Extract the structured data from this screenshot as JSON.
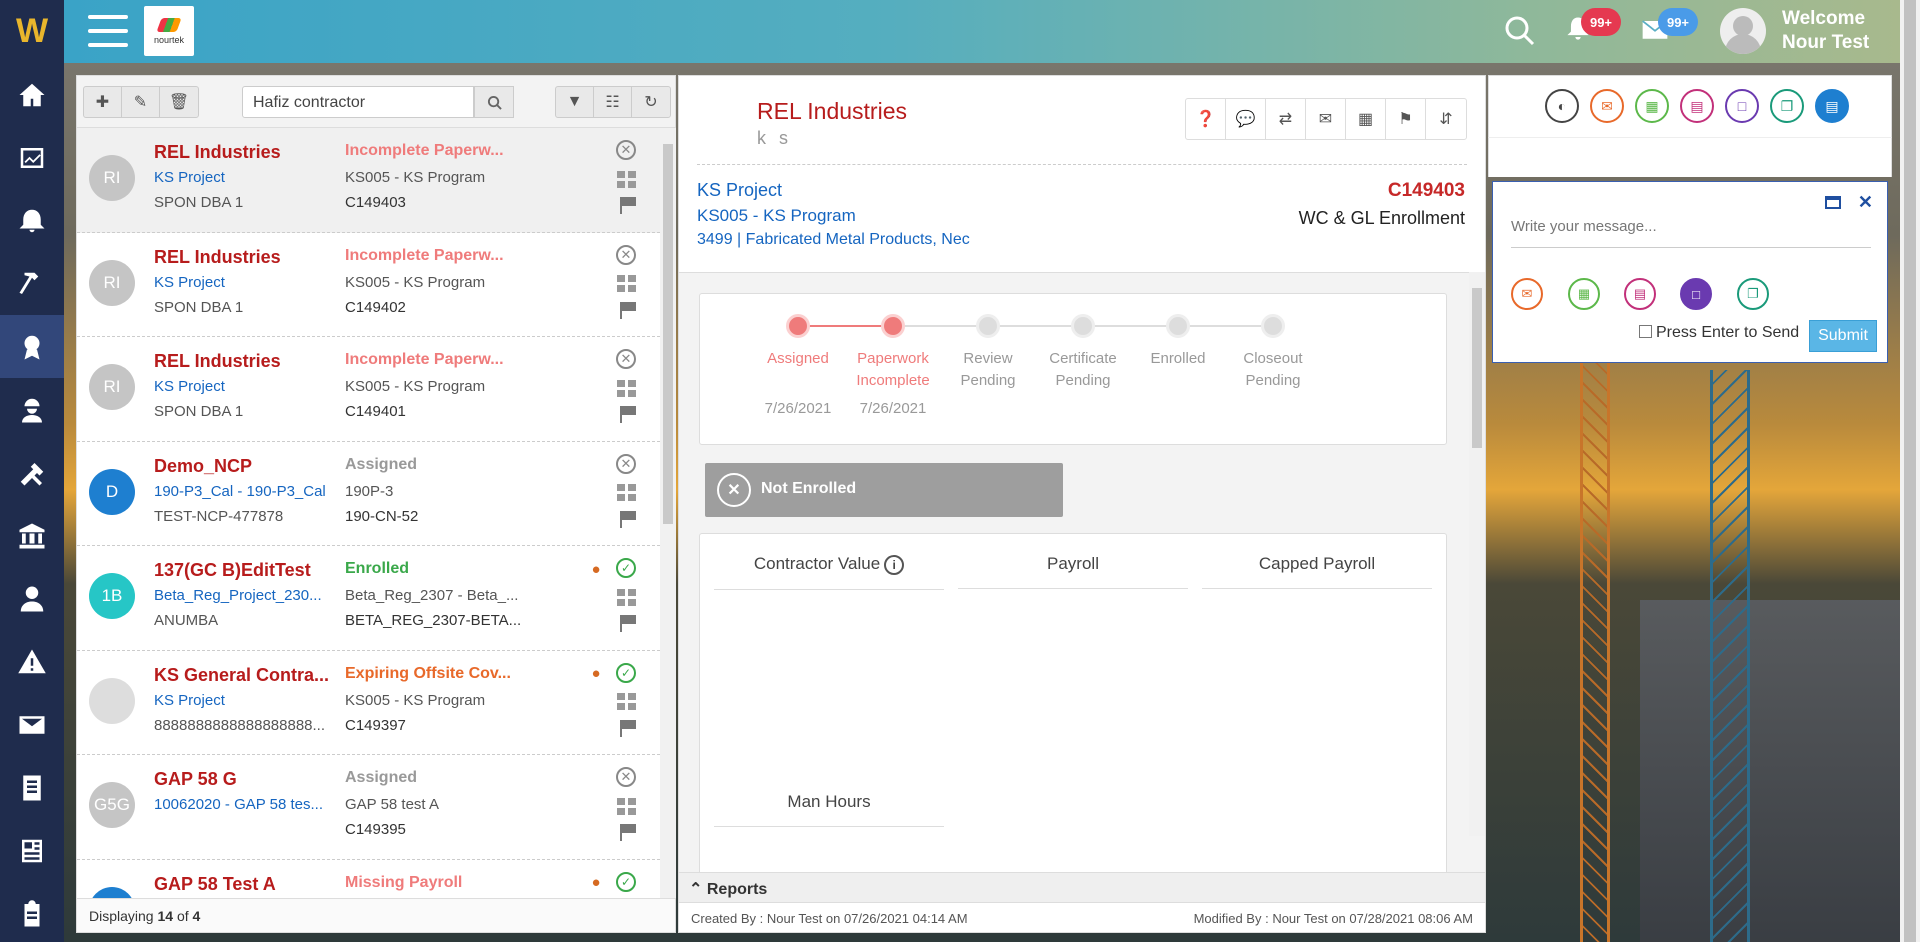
{
  "colors": {
    "brand_red": "#b71c1c",
    "link_blue": "#1565c0",
    "sidebar_bg": "#1f2c4d",
    "accent_green": "#3aa84a",
    "step_done": "#ef7b7b"
  },
  "header": {
    "brand_text": "nourtek",
    "notifications_badge": "99+",
    "mail_badge": "99+",
    "welcome_line1": "Welcome",
    "welcome_line2": "Nour Test"
  },
  "sidebar": {
    "logo": "W",
    "items": [
      {
        "icon": "home-icon"
      },
      {
        "icon": "chart-icon"
      },
      {
        "icon": "bell-icon"
      },
      {
        "icon": "hammer-icon"
      },
      {
        "icon": "award-icon",
        "active": true
      },
      {
        "icon": "worker-icon"
      },
      {
        "icon": "tools-icon"
      },
      {
        "icon": "bank-icon"
      },
      {
        "icon": "agent-icon"
      },
      {
        "icon": "warning-icon"
      },
      {
        "icon": "mail-icon"
      },
      {
        "icon": "document-icon"
      },
      {
        "icon": "newspaper-icon"
      },
      {
        "icon": "clipboard-icon"
      }
    ]
  },
  "list_panel": {
    "search_value": "Hafiz contractor",
    "footer_prefix": "Displaying",
    "footer_count": "14",
    "footer_of": "of",
    "footer_total": "4",
    "rows": [
      {
        "initials": "RI",
        "avatar_color": "#c5c5c5",
        "name": "REL Industries",
        "project": "KS Project",
        "dba": "SPON DBA 1",
        "status": "Incomplete Paperw...",
        "status_color": "#ef7b7b",
        "program": "KS005 - KS Program",
        "contract": "C149403",
        "state": "x",
        "selected": true
      },
      {
        "initials": "RI",
        "avatar_color": "#c5c5c5",
        "name": "REL Industries",
        "project": "KS Project",
        "dba": "SPON DBA 1",
        "status": "Incomplete Paperw...",
        "status_color": "#ef7b7b",
        "program": "KS005 - KS Program",
        "contract": "C149402",
        "state": "x"
      },
      {
        "initials": "RI",
        "avatar_color": "#c5c5c5",
        "name": "REL Industries",
        "project": "KS Project",
        "dba": "SPON DBA 1",
        "status": "Incomplete Paperw...",
        "status_color": "#ef7b7b",
        "program": "KS005 - KS Program",
        "contract": "C149401",
        "state": "x"
      },
      {
        "initials": "D",
        "avatar_color": "#1e7fd0",
        "name": "Demo_NCP",
        "project": "190-P3_Cal - 190-P3_Cal",
        "dba": "TEST-NCP-477878",
        "status": "Assigned",
        "status_color": "#999999",
        "program": "190P-3",
        "contract": "190-CN-52",
        "state": "x"
      },
      {
        "initials": "1B",
        "avatar_color": "#26c6c6",
        "name": "137(GC B)EditTest",
        "project": "Beta_Reg_Project_230...",
        "dba": "ANUMBA",
        "status": "Enrolled",
        "status_color": "#3aa84a",
        "program": "Beta_Reg_2307 - Beta_...",
        "contract": "BETA_REG_2307-BETA...",
        "state": "ok"
      },
      {
        "initials": "",
        "avatar_color": "#dddddd",
        "name": "KS General Contra...",
        "project": "KS Project",
        "dba": "8888888888888888888...",
        "status": "Expiring Offsite Cov...",
        "status_color": "#e8692a",
        "program": "KS005 - KS Program",
        "contract": "C149397",
        "state": "ok"
      },
      {
        "initials": "G5G",
        "avatar_color": "#c5c5c5",
        "name": "GAP 58 G",
        "project": "10062020 - GAP 58 tes...",
        "dba": "",
        "status": "Assigned",
        "status_color": "#999999",
        "program": "GAP 58 test A",
        "contract": "C149395",
        "state": "x"
      },
      {
        "initials": "",
        "avatar_color": "#1e7fd0",
        "name": "GAP 58 Test A",
        "project": "",
        "dba": "",
        "status": "Missing Payroll",
        "status_color": "#ef7b7b",
        "program": "",
        "contract": "",
        "state": "ok"
      }
    ]
  },
  "detail": {
    "title": "REL Industries",
    "subtitle": "k s",
    "project": "KS Project",
    "program": "KS005 - KS Program",
    "sic": "3499 | Fabricated Metal Products, Nec",
    "contract_id": "C149403",
    "enrollment": "WC & GL Enrollment",
    "steps": [
      {
        "label_1": "Assigned",
        "label_2": "",
        "date": "7/26/2021",
        "done": true
      },
      {
        "label_1": "Paperwork",
        "label_2": "Incomplete",
        "date": "7/26/2021",
        "done": true
      },
      {
        "label_1": "Review",
        "label_2": "Pending",
        "date": "",
        "done": false
      },
      {
        "label_1": "Certificate",
        "label_2": "Pending",
        "date": "",
        "done": false
      },
      {
        "label_1": "Enrolled",
        "label_2": "",
        "date": "",
        "done": false
      },
      {
        "label_1": "Closeout",
        "label_2": "Pending",
        "date": "",
        "done": false
      }
    ],
    "not_enrolled": "Not Enrolled",
    "contractor_value": "Contractor Value",
    "info": "i",
    "payroll": "Payroll",
    "capped_payroll": "Capped Payroll",
    "man_hours": "Man Hours",
    "reports": "Reports",
    "created_by": "Created By : Nour Test on 07/26/2021 04:14 AM",
    "modified_by": "Modified By : Nour Test on 07/28/2021 08:06 AM"
  },
  "messages": {
    "placeholder": "Write your message...",
    "press_enter": "Press Enter to Send",
    "submit": "Submit",
    "top_icons": [
      {
        "name": "dashboard-icon",
        "color": "#444444"
      },
      {
        "name": "email-icon",
        "color": "#e8692a"
      },
      {
        "name": "calendar-icon",
        "color": "#5cb84a"
      },
      {
        "name": "document-icon",
        "color": "#c2307a"
      },
      {
        "name": "note-icon",
        "color": "#6a3ab0"
      },
      {
        "name": "copy-icon",
        "color": "#1a9a7a"
      },
      {
        "name": "book-icon",
        "color": "#1e7fd0"
      }
    ]
  }
}
